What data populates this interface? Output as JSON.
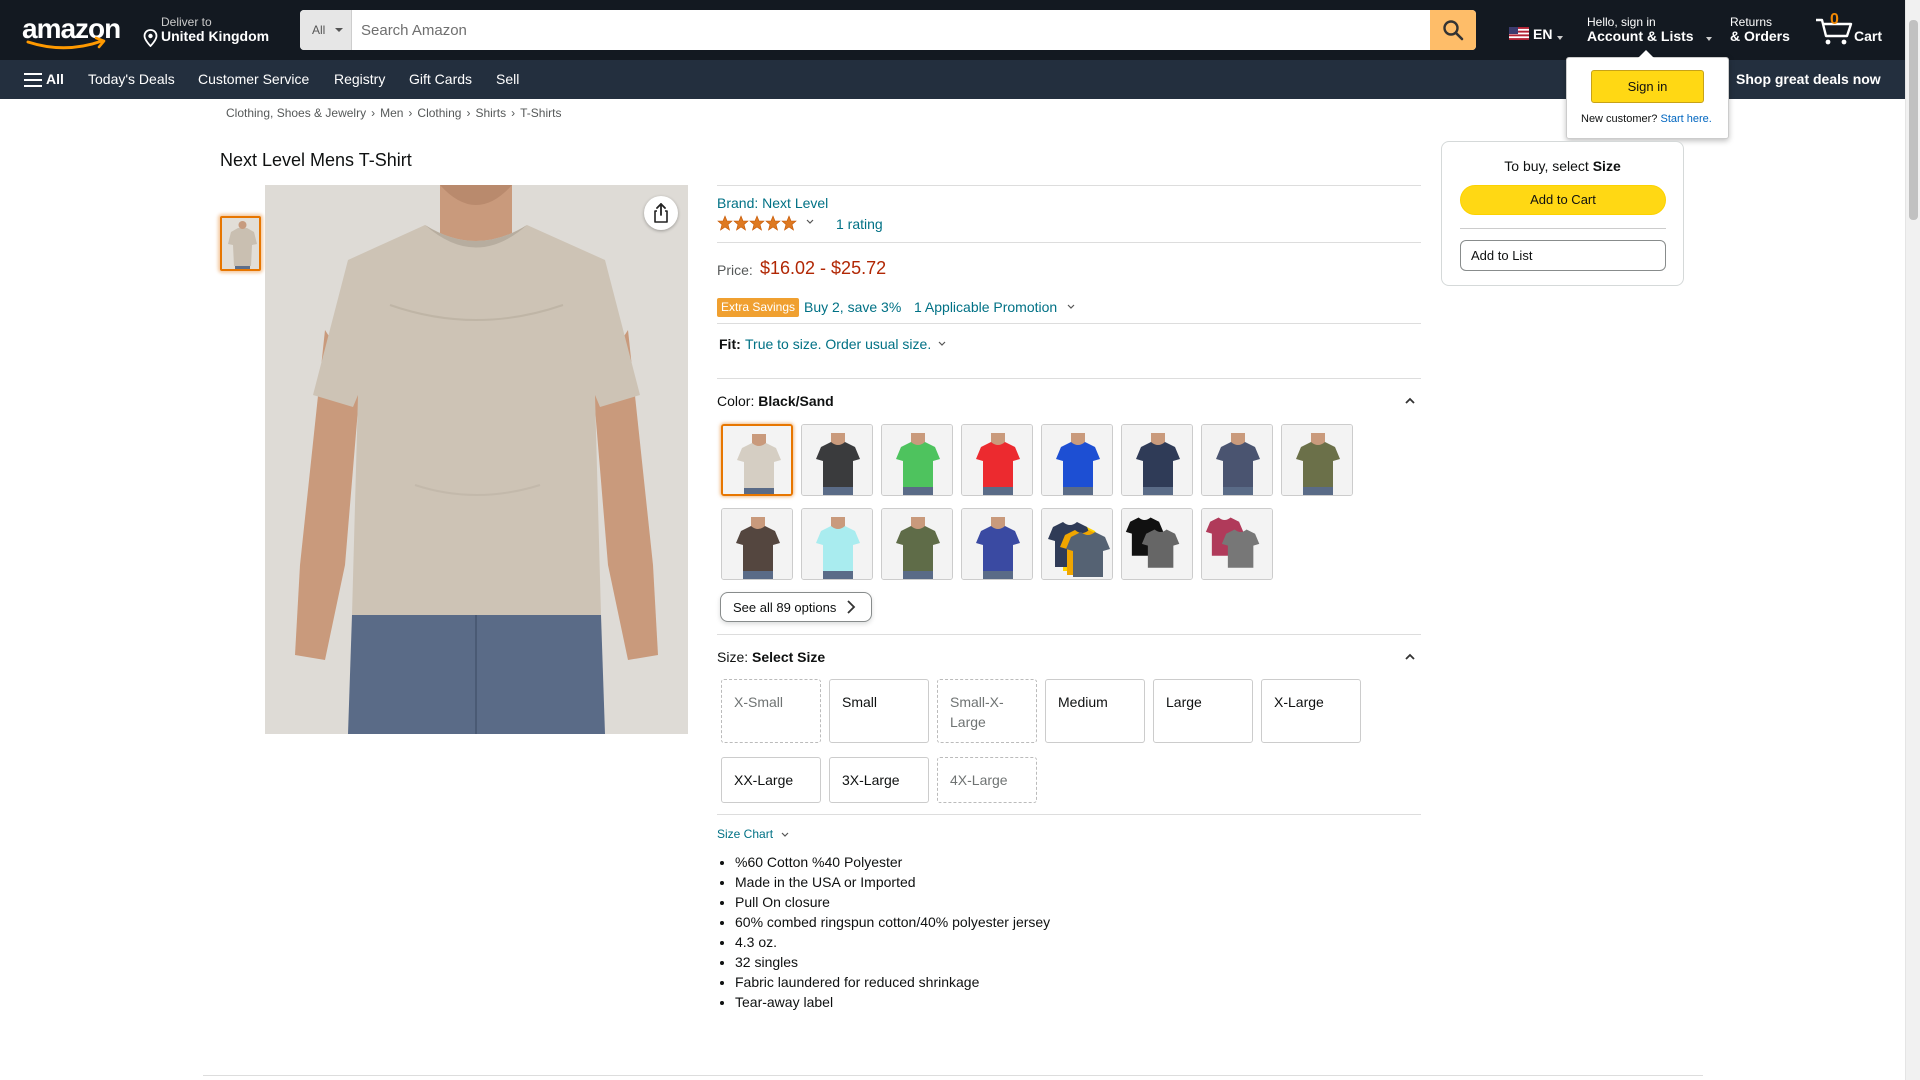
{
  "header": {
    "deliver_line1": "Deliver to",
    "deliver_line2": "United Kingdom",
    "search_dept": "All",
    "search_placeholder": "Search Amazon",
    "lang": "EN",
    "account_line1": "Hello, sign in",
    "account_line2": "Account & Lists",
    "returns_line1": "Returns",
    "returns_line2": "& Orders",
    "cart_count": "0",
    "cart_label": "Cart"
  },
  "subnav": {
    "all": "All",
    "items": [
      "Today's Deals",
      "Customer Service",
      "Registry",
      "Gift Cards",
      "Sell"
    ],
    "promo": "Shop great deals now"
  },
  "flyout": {
    "signin": "Sign in",
    "new_customer": "New customer?",
    "start_here": "Start here."
  },
  "breadcrumb": [
    "Clothing, Shoes & Jewelry",
    "Men",
    "Clothing",
    "Shirts",
    "T-Shirts"
  ],
  "product": {
    "title": "Next Level Mens T-Shirt",
    "brand": "Brand: Next Level",
    "rating_stars": 5,
    "rating_count": "1 rating",
    "price_label": "Price:",
    "price": "$16.02 - $25.72",
    "extra_badge": "Extra Savings",
    "extra_text": "Buy 2, save 3%",
    "promotion": "1 Applicable Promotion",
    "fit_label": "Fit:",
    "fit_text": "True to size. Order usual size.",
    "color_label": "Color:",
    "color_value": "Black/Sand",
    "see_all": "See all 89 options",
    "size_label": "Size:",
    "size_value": "Select Size",
    "size_chart": "Size Chart",
    "features": [
      "%60 Cotton %40 Polyester",
      "Made in the USA or Imported",
      "Pull On closure",
      "60% combed ringspun cotton/40% polyester jersey",
      "4.3 oz.",
      "32 singles",
      "Fabric laundered for reduced shrinkage",
      "Tear-away label"
    ]
  },
  "swatches": [
    {
      "color": "#d5cec3",
      "selected": true
    },
    {
      "color": "#3a3b3d"
    },
    {
      "color": "#4ec35e"
    },
    {
      "color": "#ec2a2f"
    },
    {
      "color": "#1d4fd3"
    },
    {
      "color": "#2f3b57"
    },
    {
      "color": "#4a5470"
    },
    {
      "color": "#6b7049"
    },
    {
      "color": "#54463f"
    },
    {
      "color": "#a9ecef"
    },
    {
      "color": "#5f6c48"
    },
    {
      "color": "#3a4aa2"
    },
    {
      "color": "multi-pack"
    },
    {
      "color": "black-grey"
    },
    {
      "color": "red-grey"
    }
  ],
  "sizes": [
    {
      "label": "X-Small",
      "available": false
    },
    {
      "label": "Small",
      "available": true
    },
    {
      "label": "Small-X-Large",
      "available": false
    },
    {
      "label": "Medium",
      "available": true
    },
    {
      "label": "Large",
      "available": true
    },
    {
      "label": "X-Large",
      "available": true
    },
    {
      "label": "XX-Large",
      "available": true
    },
    {
      "label": "3X-Large",
      "available": true
    },
    {
      "label": "4X-Large",
      "available": false
    }
  ],
  "buybox": {
    "select_prefix": "To buy, select ",
    "select_value": "Size",
    "add_to_cart": "Add to Cart",
    "add_to_list": "Add to List"
  },
  "colors": {
    "nav_dark": "#131921",
    "nav_secondary": "#232F3E",
    "accent_orange": "#FEBD69",
    "button_yellow": "#FFD814",
    "price_red": "#B12704",
    "link_teal": "#007185",
    "star_orange": "#DE7921"
  }
}
